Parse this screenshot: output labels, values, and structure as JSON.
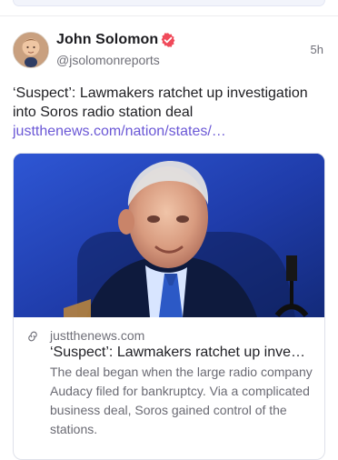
{
  "post": {
    "author": {
      "name": "John Solomon",
      "handle": "@jsolomonreports",
      "verified": true,
      "badge_color": "#f04a5a"
    },
    "time": "5h",
    "text": "‘Suspect’: Lawmakers ratchet up investigation into Soros radio station deal",
    "link_text": "justthenews.com/nation/states/…",
    "link_color": "#6b58d6"
  },
  "card": {
    "domain": "justthenews.com",
    "title": "‘Suspect’: Lawmakers ratchet up inve…",
    "description": "The deal began when the large radio company Audacy filed for bankruptcy. Via a complicated business deal, Soros gained control of the stations."
  },
  "icons": {
    "avatar": "profile-photo",
    "verified": "verified-badge-icon",
    "link": "link-icon"
  }
}
